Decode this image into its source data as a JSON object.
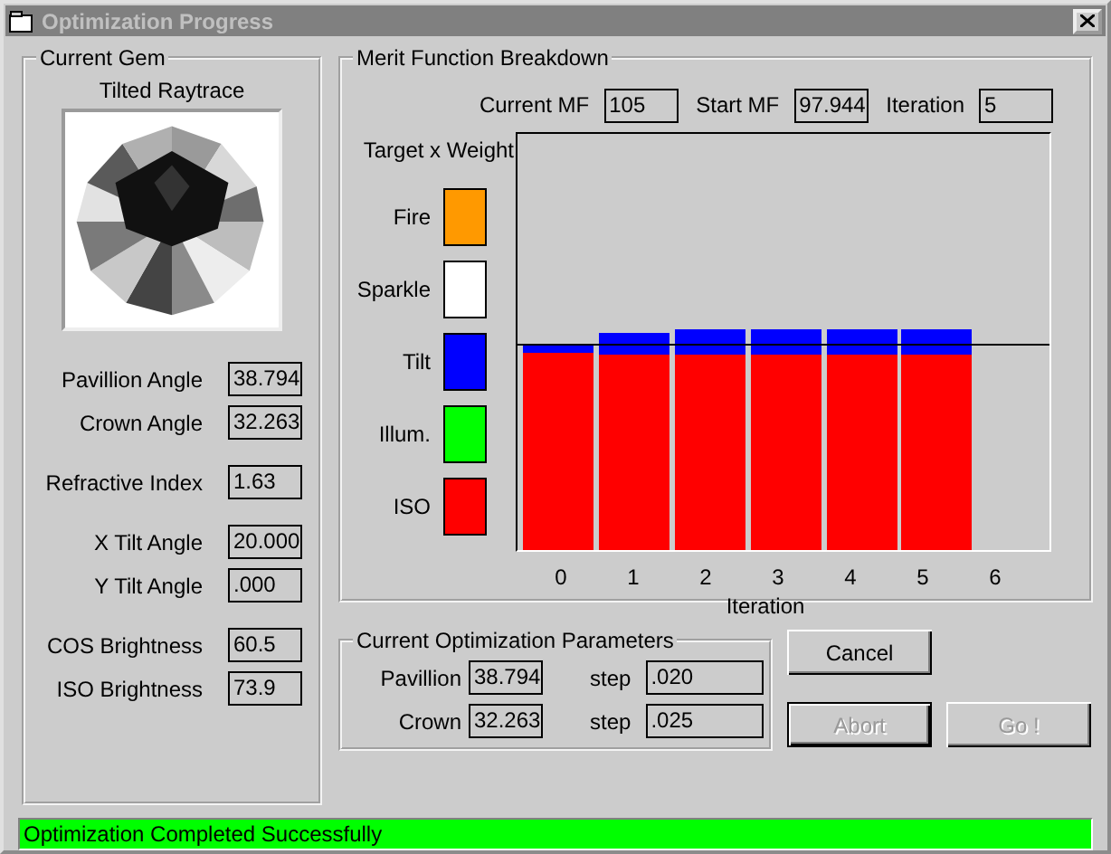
{
  "window": {
    "title": "Optimization Progress"
  },
  "current_gem": {
    "title": "Current Gem",
    "image_label": "Tilted Raytrace",
    "field_groups": [
      [
        {
          "label": "Pavillion Angle",
          "value": "38.794"
        },
        {
          "label": "Crown Angle",
          "value": "32.263"
        }
      ],
      [
        {
          "label": "Refractive Index",
          "value": "1.63"
        }
      ],
      [
        {
          "label": "X Tilt Angle",
          "value": "20.000"
        },
        {
          "label": "Y Tilt Angle",
          "value": ".000"
        }
      ],
      [
        {
          "label": "COS Brightness",
          "value": "60.5"
        },
        {
          "label": "ISO Brightness",
          "value": "73.9"
        }
      ]
    ]
  },
  "merit": {
    "title": "Merit Function Breakdown",
    "readouts": [
      {
        "label": "Current MF",
        "value": "105"
      },
      {
        "label": "Start MF",
        "value": "97.944"
      },
      {
        "label": "Iteration",
        "value": "5"
      }
    ],
    "legend_title": "Target x Weight",
    "legend": [
      {
        "label": "Fire",
        "color": "#ff9900"
      },
      {
        "label": "Sparkle",
        "color": "#ffffff"
      },
      {
        "label": "Tilt",
        "color": "#0000ff"
      },
      {
        "label": "Illum.",
        "color": "#00ff00"
      },
      {
        "label": "ISO",
        "color": "#ff0000"
      }
    ],
    "x_labels": [
      "0",
      "1",
      "2",
      "3",
      "4",
      "5",
      "6"
    ],
    "xlabel": "Iteration"
  },
  "params": {
    "title": "Current Optimization Parameters",
    "rows": [
      {
        "label": "Pavillion",
        "value": "38.794",
        "step_label": "step",
        "step": ".020"
      },
      {
        "label": "Crown",
        "value": "32.263",
        "step_label": "step",
        "step": ".025"
      }
    ]
  },
  "buttons": [
    {
      "label": "Cancel",
      "disabled": false,
      "default": false
    },
    {
      "label": "Abort",
      "disabled": true,
      "default": true
    },
    {
      "label": "Go !",
      "disabled": true,
      "default": false
    }
  ],
  "status": {
    "text": "Optimization Completed Successfully"
  }
}
